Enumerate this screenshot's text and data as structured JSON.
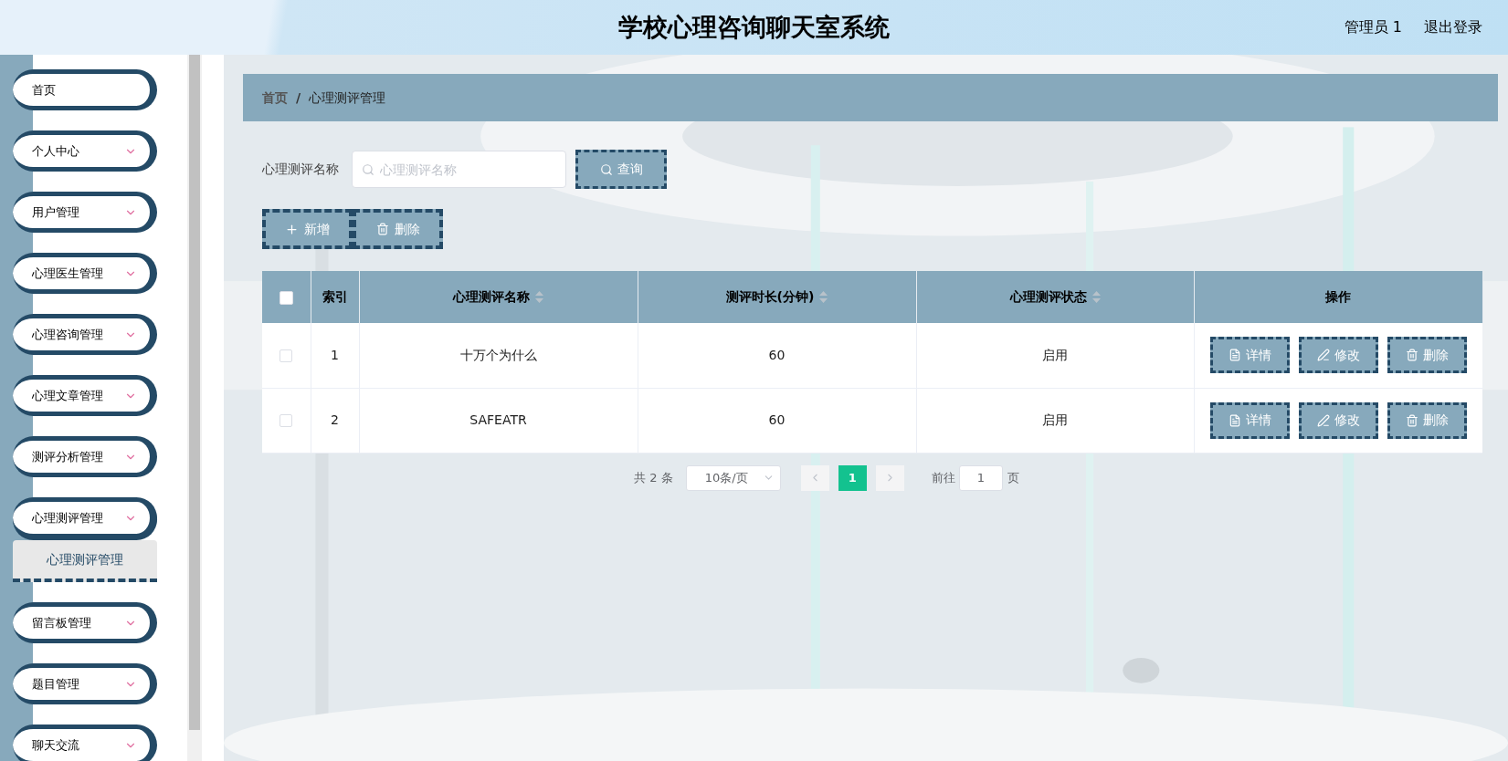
{
  "header": {
    "title": "学校心理咨询聊天室系统",
    "user": "管理员 1",
    "logout": "退出登录"
  },
  "sidebar": {
    "items": [
      {
        "label": "首页",
        "kind": "link",
        "expanded": false
      },
      {
        "label": "个人中心",
        "kind": "submenu",
        "expanded": false
      },
      {
        "label": "用户管理",
        "kind": "submenu",
        "expanded": false
      },
      {
        "label": "心理医生管理",
        "kind": "submenu",
        "expanded": false
      },
      {
        "label": "心理咨询管理",
        "kind": "submenu",
        "expanded": false
      },
      {
        "label": "心理文章管理",
        "kind": "submenu",
        "expanded": false
      },
      {
        "label": "测评分析管理",
        "kind": "submenu",
        "expanded": false
      },
      {
        "label": "心理测评管理",
        "kind": "submenu",
        "expanded": true,
        "children": [
          {
            "label": "心理测评管理",
            "selected": true
          }
        ]
      },
      {
        "label": "留言板管理",
        "kind": "submenu",
        "expanded": false
      },
      {
        "label": "题目管理",
        "kind": "submenu",
        "expanded": false
      },
      {
        "label": "聊天交流",
        "kind": "submenu",
        "expanded": false
      }
    ]
  },
  "breadcrumb": [
    "首页",
    "/",
    "心理测评管理"
  ],
  "search": {
    "label": "心理测评名称",
    "placeholder": "心理测评名称",
    "button": "查询"
  },
  "toolbar": [
    {
      "label": "新增",
      "kind": "add"
    },
    {
      "label": "删除",
      "kind": "delete"
    }
  ],
  "table": {
    "select_all": {
      "checked": false
    },
    "columns": [
      {
        "label": "索引",
        "sortable": false
      },
      {
        "label": "心理测评名称",
        "sortable": true
      },
      {
        "label": "测评时长(分钟)",
        "sortable": true
      },
      {
        "label": "心理测评状态",
        "sortable": true
      },
      {
        "label": "操作",
        "sortable": false
      }
    ],
    "rows": [
      {
        "checked": false,
        "cells": [
          "1",
          "十万个为什么",
          "60",
          "启用"
        ],
        "actions": [
          {
            "label": "详情",
            "kind": "detail"
          },
          {
            "label": "修改",
            "kind": "edit"
          },
          {
            "label": "删除",
            "kind": "delete"
          }
        ]
      },
      {
        "checked": false,
        "cells": [
          "2",
          "SAFEATR",
          "60",
          "启用"
        ],
        "actions": [
          {
            "label": "详情",
            "kind": "detail"
          },
          {
            "label": "修改",
            "kind": "edit"
          },
          {
            "label": "删除",
            "kind": "delete"
          }
        ]
      }
    ]
  },
  "pagination": {
    "total": "共 2 条",
    "page_size": "10条/页",
    "prev_disabled": true,
    "next_disabled": true,
    "pages": [
      {
        "label": "1",
        "selected": true
      }
    ],
    "goto_label": "前往",
    "goto_value": "1",
    "goto_suffix": "页"
  }
}
